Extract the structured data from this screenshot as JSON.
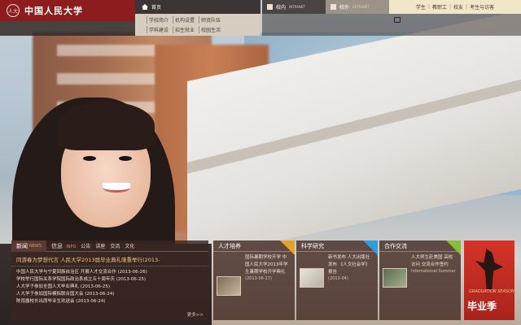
{
  "brand": {
    "name": "中国人民大学",
    "seal_text": "人大"
  },
  "nav": {
    "home": "首页",
    "links": [
      "学校简介",
      "机构设置",
      "师资队伍",
      "学科建设",
      "招生就业",
      "校园生活"
    ]
  },
  "tabs": [
    {
      "label": "校内",
      "sub": "INTRANET"
    },
    {
      "label": "校外",
      "sub": "EXTRANET"
    }
  ],
  "quick_links": [
    "学生",
    "教职工",
    "校友",
    "考生与访客"
  ],
  "news": {
    "tab_active": "新闻",
    "tab_active_en": "NEWS",
    "tab_other": "信息",
    "tab_other_en": "INFO",
    "sub_links": [
      "公告",
      "讲座",
      "交流",
      "文化"
    ],
    "headline": "同游春为梦想代言 人民大学2013届毕业典礼隆重举行(2013-",
    "items": [
      "中国人民大学与宁夏回族自治区 开展人才交流合作 (2013-06-26)",
      "学校举行国际关系学院国际政治系成立五十周年庆 (2013-06-25)",
      "人大学子参加全国人大毕业典礼 (2013-06-25)",
      "人大学子参加国际模拟联合国大会 (2013-06-24)",
      "陈雨露校长出席毕业生欢送会 (2013-06-24)"
    ],
    "more": "更多>>"
  },
  "cards": [
    {
      "title": "人才培养",
      "ribbon_color": "#e3a32a",
      "text": "国际暑期学校开学 中国人民大学2013年学生暑期学校开学典礼",
      "date": "(2013-06-17)"
    },
    {
      "title": "科学研究",
      "ribbon_color": "#2f9bd7",
      "text": "新书发布 人大出版社发布 《人文社会学》报告",
      "date": "(2013-04)"
    },
    {
      "title": "合作交流",
      "ribbon_color": "#8bbd3b",
      "text": "人大师生赴美国 高校访问 交流合作签约",
      "date": "International Summer"
    }
  ],
  "banner": {
    "en": "GRADUATION SEASON",
    "cn": "毕业季"
  },
  "colors": {
    "brand_red": "#8d1c1f",
    "panel_brown": "#382420",
    "accent_gold": "#f4c07e"
  }
}
